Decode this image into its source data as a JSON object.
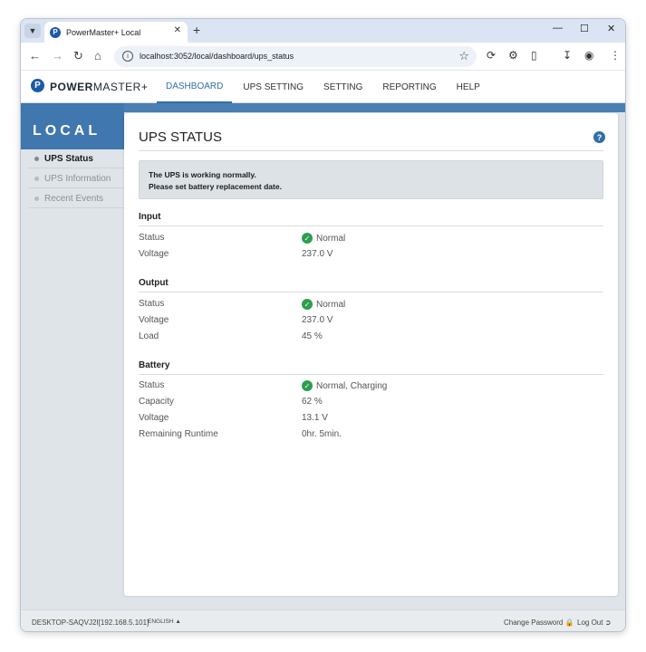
{
  "browser": {
    "tab_title": "PowerMaster+ Local",
    "favicon_letter": "P",
    "url": "localhost:3052/local/dashboard/ups_status"
  },
  "app": {
    "logo_bold": "POWER",
    "logo_rest": "MASTER+",
    "menu": [
      "DASHBOARD",
      "UPS SETTING",
      "SETTING",
      "REPORTING",
      "HELP"
    ],
    "active_menu": "DASHBOARD"
  },
  "sidebar": {
    "title": "LOCAL",
    "items": [
      {
        "label": "UPS Status",
        "active": true
      },
      {
        "label": "UPS Information",
        "active": false
      },
      {
        "label": "Recent Events",
        "active": false
      }
    ]
  },
  "panel": {
    "title": "UPS STATUS",
    "notice_line1": "The UPS is working normally.",
    "notice_line2": "Please set battery replacement date.",
    "sections": {
      "input": {
        "title": "Input",
        "status_label": "Status",
        "status_value": "Normal",
        "voltage_label": "Voltage",
        "voltage_value": "237.0 V"
      },
      "output": {
        "title": "Output",
        "status_label": "Status",
        "status_value": "Normal",
        "voltage_label": "Voltage",
        "voltage_value": "237.0 V",
        "load_label": "Load",
        "load_value": "45 %"
      },
      "battery": {
        "title": "Battery",
        "status_label": "Status",
        "status_value": "Normal, Charging",
        "capacity_label": "Capacity",
        "capacity_value": "62 %",
        "voltage_label": "Voltage",
        "voltage_value": "13.1 V",
        "runtime_label": "Remaining Runtime",
        "runtime_value": "0hr. 5min."
      }
    }
  },
  "footer": {
    "host": "DESKTOP-SAQVJ2I[192.168.5.101]",
    "language": "ENGLISH",
    "change_password": "Change Password",
    "log_out": "Log Out"
  },
  "colors": {
    "accent": "#2f6fa6",
    "sidebar_header": "#3f77ae",
    "ok_green": "#2e9e4f"
  },
  "icons": [
    "chevron-down-icon",
    "close-icon",
    "plus-icon",
    "minimize-icon",
    "maximize-icon",
    "back-icon",
    "forward-icon",
    "reload-icon",
    "home-icon",
    "site-info-icon",
    "star-icon",
    "extension-icon",
    "download-icon",
    "profile-icon",
    "kebab-menu-icon",
    "help-icon",
    "check-circle-icon",
    "lock-icon",
    "logout-icon"
  ]
}
